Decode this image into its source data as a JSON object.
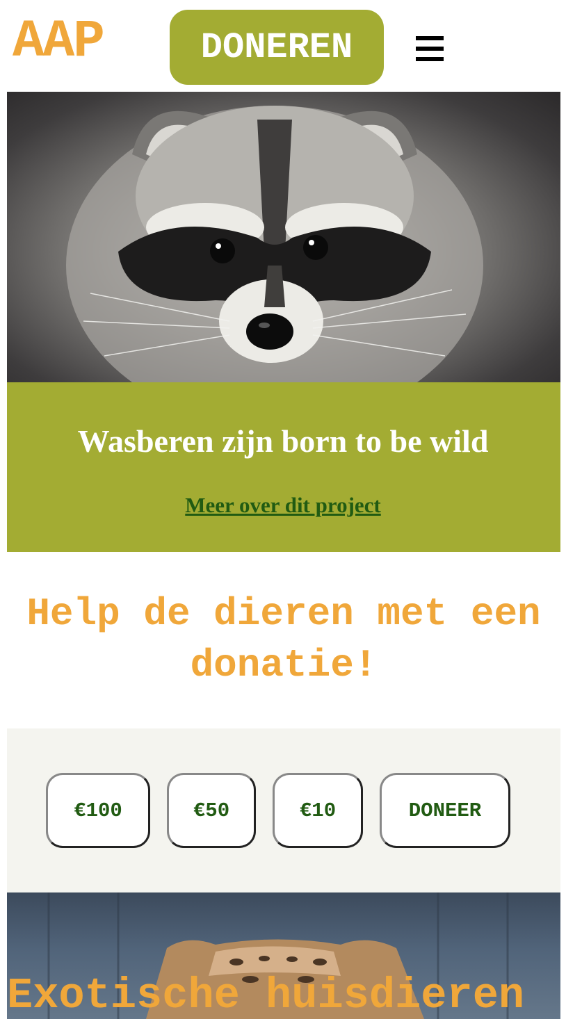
{
  "header": {
    "logo": "AAP",
    "donate_label": "DONEREN",
    "menu_icon": "hamburger-menu-icon"
  },
  "hero": {
    "image": "raccoon-photo"
  },
  "project": {
    "title": "Wasberen zijn born to be wild",
    "link": "Meer over dit project"
  },
  "donation": {
    "heading": "Help de dieren met een donatie!",
    "amounts": [
      "€100",
      "€50",
      "€10"
    ],
    "submit_label": "DONEER"
  },
  "next_section": {
    "image": "exotic-cat-photo",
    "title": "Exotische huisdieren"
  },
  "colors": {
    "accent_orange": "#f0a73a",
    "olive_green": "#a3ac33",
    "dark_green": "#215b12",
    "light_bg": "#f4f4ef"
  }
}
